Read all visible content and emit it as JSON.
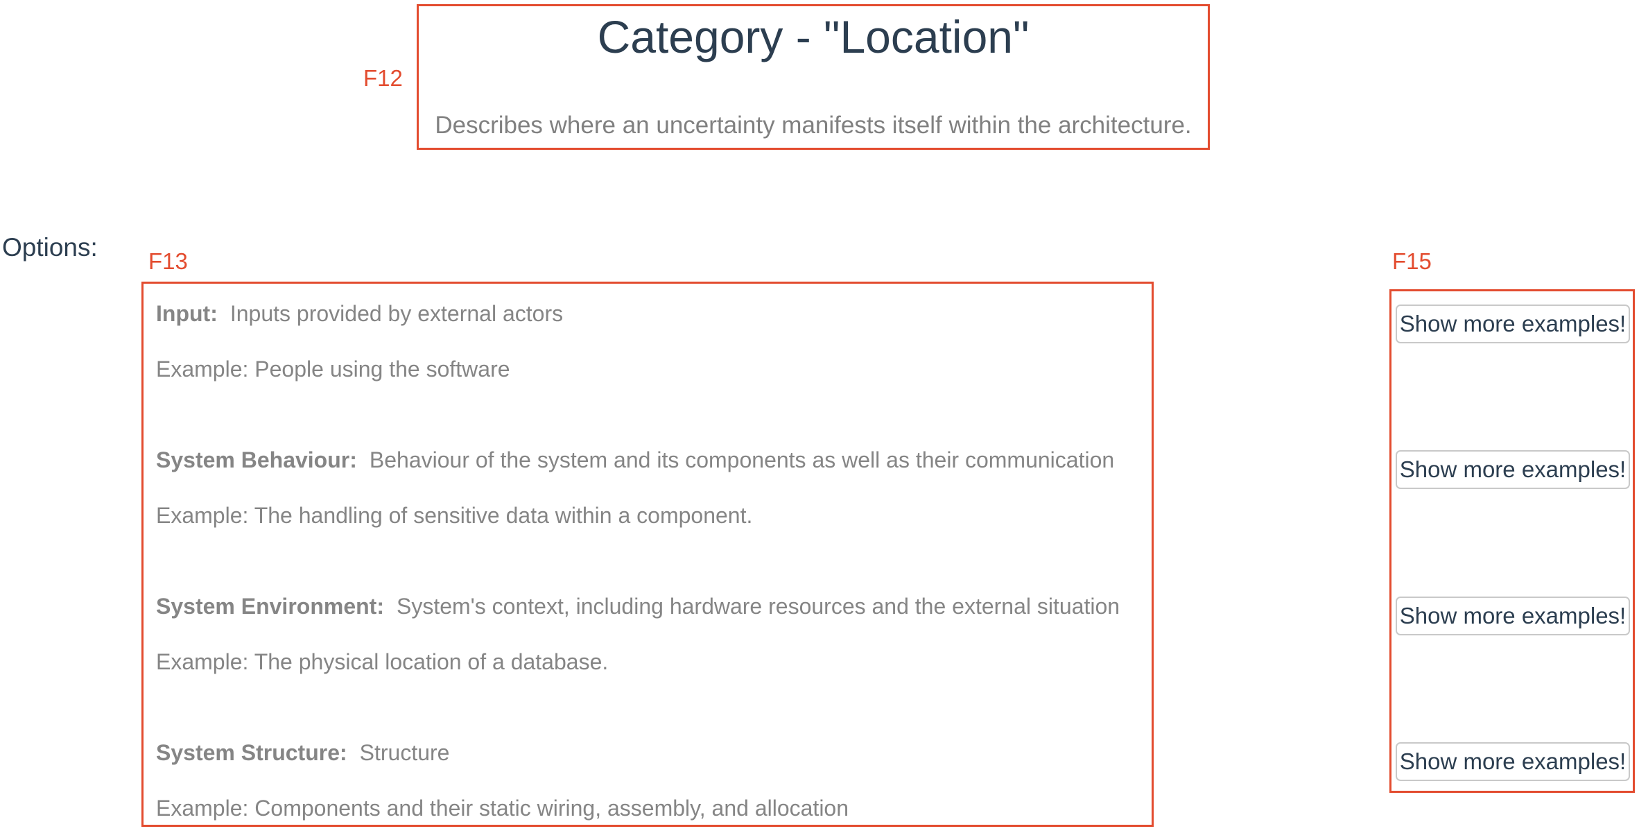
{
  "annotations": {
    "header_label": "F12",
    "options_label": "F13",
    "buttons_label": "F15",
    "color": "#e34c2f"
  },
  "category": {
    "title": "Category - \"Location\"",
    "description": "Describes where an uncertainty manifests itself within the architecture."
  },
  "options_heading": "Options:",
  "options": [
    {
      "name": "Input:",
      "description": "Inputs provided by external actors",
      "example": "Example: People using the software",
      "button_label": "Show more examples!"
    },
    {
      "name": "System Behaviour:",
      "description": "Behaviour of the system and its components as well as their communication",
      "example": "Example: The handling of sensitive data within a component.",
      "button_label": "Show more examples!"
    },
    {
      "name": "System Environment:",
      "description": "System's context, including hardware resources and the external situation",
      "example": "Example: The physical location of a database.",
      "button_label": "Show more examples!"
    },
    {
      "name": "System Structure:",
      "description": "Structure",
      "example": "Example: Components and their static wiring, assembly, and allocation",
      "button_label": "Show more examples!"
    }
  ]
}
